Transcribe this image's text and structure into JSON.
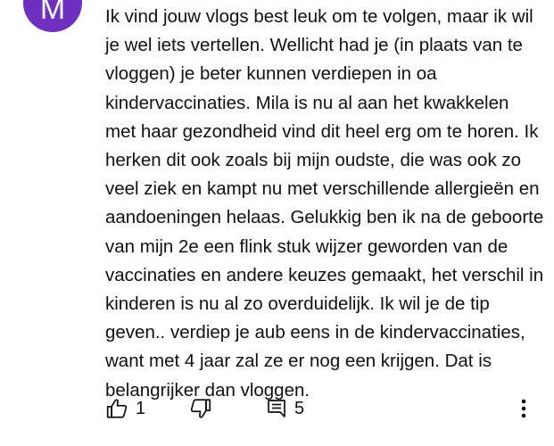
{
  "comment": {
    "avatar_letter": "M",
    "avatar_color": "#6f2fbf",
    "text": "Ik vind jouw vlogs best leuk om te volgen, maar ik wil\nje wel iets vertellen. Wellicht had je (in plaats van te\nvloggen) je beter kunnen verdiepen in oa\nkindervaccinaties. Mila is nu al aan het kwakkelen\nmet haar gezondheid vind dit heel erg om te horen. Ik\nherken dit ook zoals bij mijn oudste, die was ook zo\nveel ziek en kampt nu met verschillende allergieën en\naandoeningen helaas. Gelukkig ben ik na de geboorte\nvan mijn 2e een flink stuk wijzer geworden van de\nvaccinaties en andere keuzes gemaakt, het verschil in\nkinderen is nu al zo overduidelijk. Ik wil je de tip\ngeven.. verdiep je aub eens in de kindervaccinaties,\nwant met 4 jaar zal ze er nog een krijgen. Dat is\nbelangrijker dan vloggen."
  },
  "actions": {
    "like_count": "1",
    "reply_count": "5",
    "like_icon": "thumbs-up-icon",
    "dislike_icon": "thumbs-down-icon",
    "reply_icon": "reply-comment-icon",
    "more_icon": "more-vertical-icon"
  }
}
